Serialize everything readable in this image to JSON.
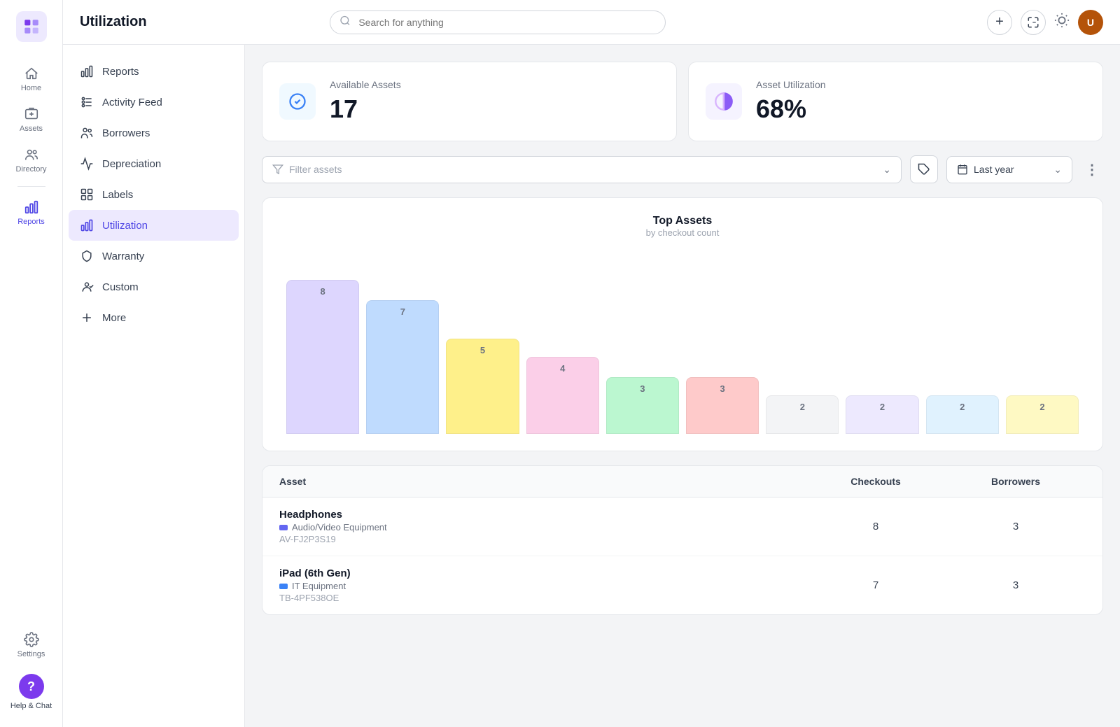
{
  "app": {
    "logo_alt": "App Logo",
    "title": "Utilization"
  },
  "topbar": {
    "search_placeholder": "Search for anything",
    "title": "Utilization"
  },
  "icon_nav": {
    "items": [
      {
        "label": "Home",
        "icon": "home-icon",
        "active": false
      },
      {
        "label": "Assets",
        "icon": "assets-icon",
        "active": false
      },
      {
        "label": "Directory",
        "icon": "directory-icon",
        "active": false
      },
      {
        "label": "Reports",
        "icon": "reports-icon",
        "active": true
      }
    ],
    "bottom": {
      "settings_label": "Settings",
      "help_label": "Help & Chat"
    }
  },
  "side_menu": {
    "items": [
      {
        "label": "Reports",
        "icon": "bar-chart-icon",
        "active": false
      },
      {
        "label": "Activity Feed",
        "icon": "activity-icon",
        "active": false
      },
      {
        "label": "Borrowers",
        "icon": "borrowers-icon",
        "active": false
      },
      {
        "label": "Depreciation",
        "icon": "depreciation-icon",
        "active": false
      },
      {
        "label": "Labels",
        "icon": "labels-icon",
        "active": false
      },
      {
        "label": "Utilization",
        "icon": "utilization-icon",
        "active": true
      },
      {
        "label": "Warranty",
        "icon": "warranty-icon",
        "active": false
      },
      {
        "label": "Custom",
        "icon": "custom-icon",
        "active": false
      },
      {
        "label": "More",
        "icon": "more-icon",
        "active": false
      }
    ]
  },
  "stats": [
    {
      "label": "Available Assets",
      "value": "17",
      "icon": "check-badge-icon",
      "icon_color": "#3b82f6"
    },
    {
      "label": "Asset Utilization",
      "value": "68%",
      "icon": "pie-chart-icon",
      "icon_color": "#8b5cf6"
    }
  ],
  "filters": {
    "asset_placeholder": "Filter assets",
    "date_label": "Last year",
    "more_label": "⋮"
  },
  "chart": {
    "title": "Top Assets",
    "subtitle": "by checkout count",
    "bars": [
      {
        "value": 8,
        "color": "#ddd6fe",
        "height_pct": 100
      },
      {
        "value": 7,
        "color": "#bfdbfe",
        "height_pct": 87
      },
      {
        "value": 5,
        "color": "#fef08a",
        "height_pct": 62
      },
      {
        "value": 4,
        "color": "#fbcfe8",
        "height_pct": 50
      },
      {
        "value": 3,
        "color": "#bbf7d0",
        "height_pct": 37
      },
      {
        "value": 3,
        "color": "#fecaca",
        "height_pct": 37
      },
      {
        "value": 2,
        "color": "#f3f4f6",
        "height_pct": 25
      },
      {
        "value": 2,
        "color": "#ede9fe",
        "height_pct": 25
      },
      {
        "value": 2,
        "color": "#e0f2fe",
        "height_pct": 25
      },
      {
        "value": 2,
        "color": "#fef9c3",
        "height_pct": 25
      }
    ]
  },
  "table": {
    "columns": [
      "Asset",
      "Checkouts",
      "Borrowers"
    ],
    "rows": [
      {
        "name": "Headphones",
        "category": "Audio/Video Equipment",
        "category_color": "#6366f1",
        "id": "AV-FJ2P3S19",
        "checkouts": 8,
        "borrowers": 3
      },
      {
        "name": "iPad (6th Gen)",
        "category": "IT Equipment",
        "category_color": "#3b82f6",
        "id": "TB-4PF538OE",
        "checkouts": 7,
        "borrowers": 3
      }
    ]
  }
}
